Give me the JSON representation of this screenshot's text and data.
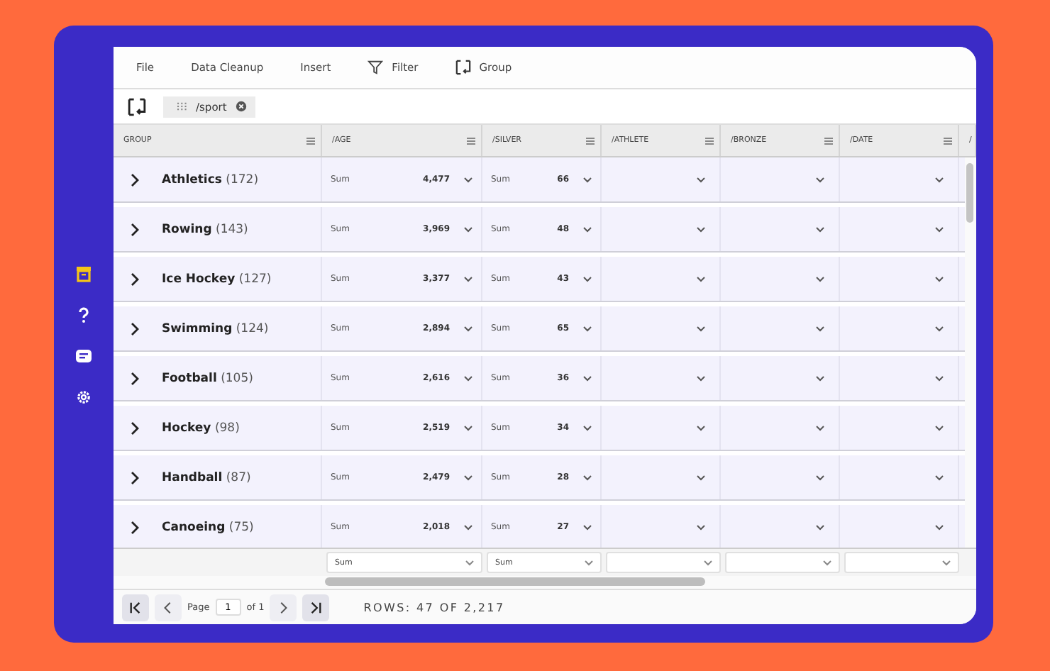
{
  "toolbar": {
    "items": [
      {
        "label": "File"
      },
      {
        "label": "Data Cleanup"
      },
      {
        "label": "Insert"
      },
      {
        "label": "Filter"
      },
      {
        "label": "Group"
      }
    ]
  },
  "group_chip": {
    "label": "/sport"
  },
  "columns": [
    {
      "label": "GROUP"
    },
    {
      "label": "/AGE"
    },
    {
      "label": "/SILVER"
    },
    {
      "label": "/ATHLETE"
    },
    {
      "label": "/BRONZE"
    },
    {
      "label": "/DATE"
    },
    {
      "label": "/"
    }
  ],
  "rows": [
    {
      "name": "Athletics",
      "count": "(172)",
      "expanded": false,
      "age_agg": "Sum",
      "age": "4,477",
      "silver_agg": "Sum",
      "silver": "66"
    },
    {
      "name": "Rowing",
      "count": "(143)",
      "expanded": false,
      "age_agg": "Sum",
      "age": "3,969",
      "silver_agg": "Sum",
      "silver": "48"
    },
    {
      "name": "Ice Hockey",
      "count": "(127)",
      "expanded": false,
      "age_agg": "Sum",
      "age": "3,377",
      "silver_agg": "Sum",
      "silver": "43"
    },
    {
      "name": "Swimming",
      "count": "(124)",
      "expanded": false,
      "age_agg": "Sum",
      "age": "2,894",
      "silver_agg": "Sum",
      "silver": "65"
    },
    {
      "name": "Football",
      "count": "(105)",
      "expanded": false,
      "age_agg": "Sum",
      "age": "2,616",
      "silver_agg": "Sum",
      "silver": "36"
    },
    {
      "name": "Hockey",
      "count": "(98)",
      "expanded": false,
      "age_agg": "Sum",
      "age": "2,519",
      "silver_agg": "Sum",
      "silver": "34"
    },
    {
      "name": "Handball",
      "count": "(87)",
      "expanded": false,
      "age_agg": "Sum",
      "age": "2,479",
      "silver_agg": "Sum",
      "silver": "28"
    },
    {
      "name": "Canoeing",
      "count": "(75)",
      "expanded": false,
      "age_agg": "Sum",
      "age": "2,018",
      "silver_agg": "Sum",
      "silver": "27"
    }
  ],
  "footer_aggregates": [
    {
      "kind": "set",
      "value": "Sum"
    },
    {
      "kind": "set",
      "value": "Sum"
    },
    {
      "kind": "empty"
    },
    {
      "kind": "empty"
    },
    {
      "kind": "empty"
    }
  ],
  "pagination": {
    "page_label": "Page",
    "page": "1",
    "of_label": "of 1",
    "rows_text": "ROWS: 47 OF 2,217"
  }
}
